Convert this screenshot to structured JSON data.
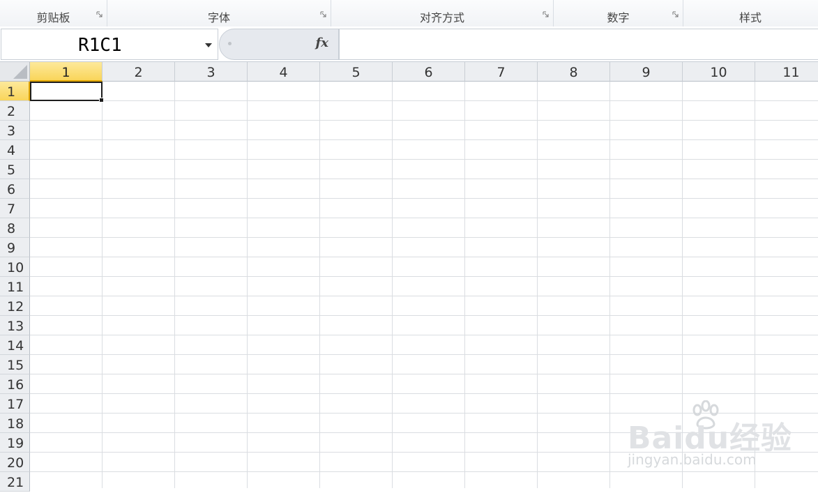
{
  "ribbon": {
    "groups": [
      {
        "label": "剪贴板"
      },
      {
        "label": "字体"
      },
      {
        "label": "对齐方式"
      },
      {
        "label": "数字"
      },
      {
        "label": "样式"
      }
    ]
  },
  "formula_bar": {
    "name_box": "R1C1",
    "fx_label": "fx",
    "formula": ""
  },
  "grid": {
    "columns": [
      "1",
      "2",
      "3",
      "4",
      "5",
      "6",
      "7",
      "8",
      "9",
      "10",
      "11"
    ],
    "rows": [
      "1",
      "2",
      "3",
      "4",
      "5",
      "6",
      "7",
      "8",
      "9",
      "10",
      "11",
      "12",
      "13",
      "14",
      "15",
      "16",
      "17",
      "18",
      "19",
      "20",
      "21"
    ],
    "active_cell": "R1C1"
  },
  "watermark": {
    "brand": "Baidu经验",
    "url": "jingyan.baidu.com",
    "logo_icon": "baidu-paw-icon"
  },
  "colors": {
    "selected_header": "#f9d55a",
    "header_bg": "#eceef1",
    "gridline": "#dadde1"
  }
}
